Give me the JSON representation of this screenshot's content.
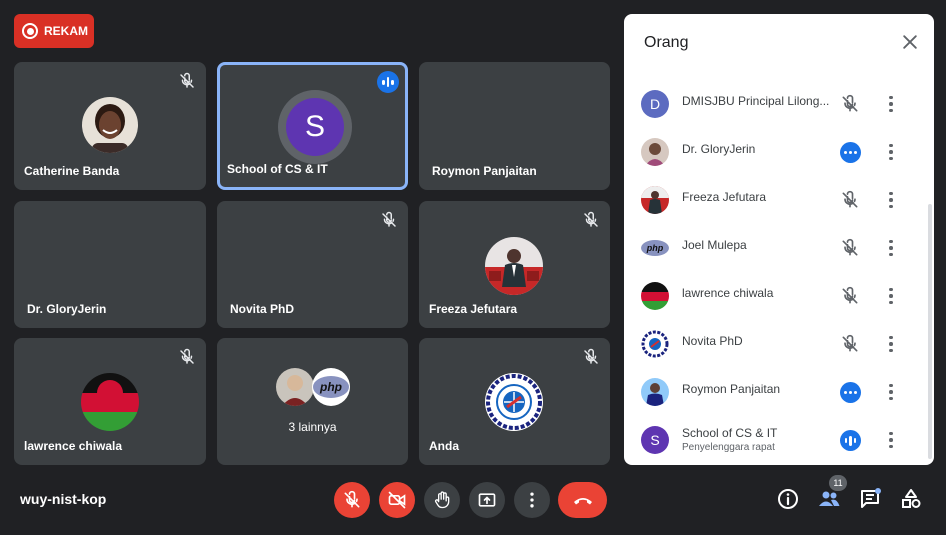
{
  "record": {
    "label": "REKAM"
  },
  "tiles": [
    {
      "name": "Catherine Banda"
    },
    {
      "name": "School of CS & IT",
      "initial": "S"
    },
    {
      "name": "Roymon Panjaitan"
    },
    {
      "name": "Dr. GloryJerin"
    },
    {
      "name": "Novita PhD"
    },
    {
      "name": "Freeza Jefutara"
    },
    {
      "name": "lawrence chiwala"
    },
    {
      "name": "3 lainnya"
    },
    {
      "name": "Anda"
    }
  ],
  "panel": {
    "title": "Orang",
    "participants": [
      {
        "initial": "D",
        "name": "DMISJBU Principal Lilong..."
      },
      {
        "name": "Dr. GloryJerin"
      },
      {
        "name": "Freeza Jefutara"
      },
      {
        "name": "Joel Mulepa",
        "avatar_text": "php"
      },
      {
        "name": "lawrence chiwala"
      },
      {
        "name": "Novita PhD"
      },
      {
        "name": "Roymon Panjaitan"
      },
      {
        "initial": "S",
        "name": "School of CS & IT",
        "subtitle": "Penyelenggara rapat"
      }
    ]
  },
  "bottom": {
    "meeting_code": "wuy-nist-kop",
    "people_count": "11"
  },
  "colors": {
    "accent": "#1a73e8",
    "danger": "#ea4335",
    "tile": "#3c4043",
    "background": "#202124"
  },
  "icons": [
    "record-icon",
    "mic-off-icon",
    "camera-off-icon",
    "raise-hand-icon",
    "present-icon",
    "more-icon",
    "end-call-icon",
    "info-icon",
    "people-icon",
    "chat-icon",
    "activities-icon",
    "close-icon"
  ]
}
